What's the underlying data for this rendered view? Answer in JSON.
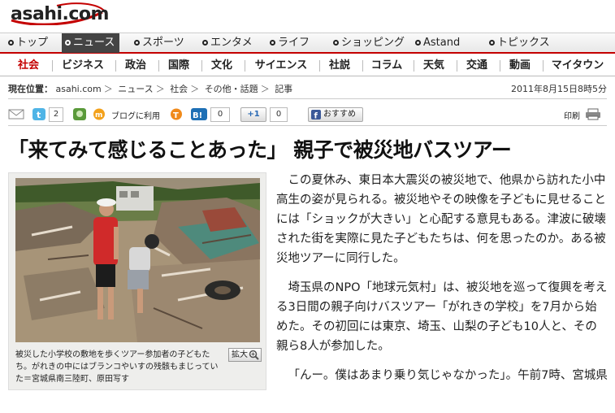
{
  "site": {
    "logo_text": "asahi.com"
  },
  "global_nav": [
    {
      "label": "トップ",
      "dot": "red"
    },
    {
      "label": "ニュース",
      "dot": "red",
      "active": true
    },
    {
      "label": "スポーツ",
      "dot": "blue"
    },
    {
      "label": "エンタメ",
      "dot": "orange"
    },
    {
      "label": "ライフ",
      "dot": "orange"
    },
    {
      "label": "ショッピング",
      "dot": "red"
    },
    {
      "label": "Astand",
      "dot": "orange"
    },
    {
      "label": "トピックス",
      "dot": "orange"
    }
  ],
  "category_nav": [
    "社会",
    "ビジネス",
    "政治",
    "国際",
    "文化",
    "サイエンス",
    "社説",
    "コラム",
    "天気",
    "交通",
    "動画",
    "マイタウン"
  ],
  "breadcrumb": {
    "prefix": "現在位置：",
    "items": [
      "asahi.com",
      "ニュース",
      "社会",
      "その他・話題",
      "記事"
    ],
    "separator": "＞"
  },
  "date": "2011年8月15日8時5分",
  "share": {
    "twitter_count": "2",
    "blog_label": "ブログに利用",
    "hatena_count": "0",
    "plusone_label": "+1",
    "plusone_count": "0",
    "facebook_label": "おすすめ",
    "print_label": "印刷"
  },
  "article": {
    "headline": "「来てみて感じることあった」 親子で被災地バスツアー",
    "photo_caption": "被災した小学校の敷地を歩くツアー参加者の子どもたち。がれきの中にはブランコやいすの残骸もまじっていた＝宮城県南三陸町、原田写す",
    "zoom_label": "拡大",
    "paragraphs": [
      "この夏休み、東日本大震災の被災地で、他県から訪れた小中高生の姿が見られる。被災地やその映像を子どもに見せることには「ショックが大きい」と心配する意見もある。津波に破壊された街を実際に見た子どもたちは、何を思ったのか。ある被災地ツアーに同行した。",
      "埼玉県のNPO「地球元気村」は、被災地を巡って復興を考える3日間の親子向けバスツアー「がれきの学校」を7月から始めた。その初回には東京、埼玉、山梨の子ども10人と、その親ら8人が参加した。",
      "「んー。僕はあまり乗り気じゃなかった」。午前7時、宮城県"
    ]
  },
  "colors": {
    "accent": "#c40000",
    "nav_active_bg": "#444444"
  }
}
